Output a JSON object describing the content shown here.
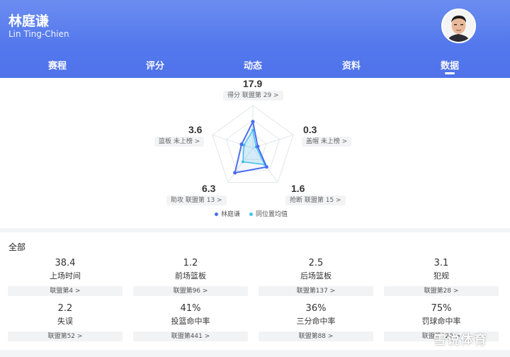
{
  "header": {
    "name": "林庭谦",
    "name_en": "Lin Ting-Chien"
  },
  "tabs": [
    {
      "label": "赛程"
    },
    {
      "label": "评分"
    },
    {
      "label": "动态"
    },
    {
      "label": "资料"
    },
    {
      "label": "数据",
      "active": true
    }
  ],
  "radar": {
    "points": [
      {
        "key": "score",
        "value": "17.9",
        "label": "得分 联盟第 29 >",
        "player": 0.62,
        "avg": 0.42
      },
      {
        "key": "block",
        "value": "0.3",
        "label": "盖帽 未上榜 >",
        "player": 0.12,
        "avg": 0.08
      },
      {
        "key": "steal",
        "value": "1.6",
        "label": "抢断 联盟第 15 >",
        "player": 0.55,
        "avg": 0.48
      },
      {
        "key": "assist",
        "value": "6.3",
        "label": "助攻 联盟第 13 >",
        "player": 0.72,
        "avg": 0.4
      },
      {
        "key": "rebound",
        "value": "3.6",
        "label": "篮板 未上榜 >",
        "player": 0.28,
        "avg": 0.22
      }
    ],
    "legend": {
      "player": "林庭谦",
      "avg": "同位置均值"
    },
    "colors": {
      "player": "#4a6ef0",
      "avg": "#45c6ea"
    }
  },
  "stats": {
    "section_title": "全部",
    "items": [
      {
        "value": "38.4",
        "label": "上场时间",
        "rank": "联盟第4 >"
      },
      {
        "value": "1.2",
        "label": "前场篮板",
        "rank": "联盟第96 >"
      },
      {
        "value": "2.5",
        "label": "后场篮板",
        "rank": "联盟第137 >"
      },
      {
        "value": "3.1",
        "label": "犯规",
        "rank": "联盟第28 >"
      },
      {
        "value": "2.2",
        "label": "失误",
        "rank": "联盟第52 >"
      },
      {
        "value": "41%",
        "label": "投篮命中率",
        "rank": "联盟第441 >"
      },
      {
        "value": "36%",
        "label": "三分命中率",
        "rank": "联盟第88 >"
      },
      {
        "value": "75%",
        "label": "罚球命中率",
        "rank": "联盟第320 >"
      }
    ]
  },
  "watermark": "雪说体育"
}
